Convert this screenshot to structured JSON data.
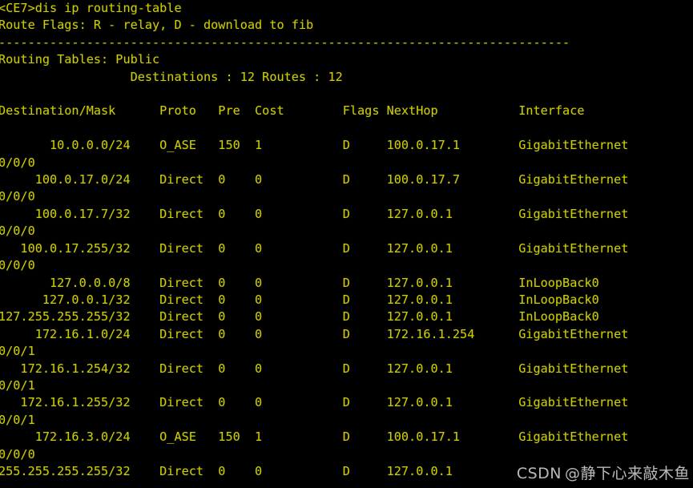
{
  "terminal": {
    "colors": {
      "background": "#000000",
      "foreground": "#cccc00"
    },
    "prompt": "<CE7>",
    "command": "dis ip routing-table",
    "prompt_line": "<CE7>dis ip routing-table",
    "route_flags_line": "Route Flags: R - relay, D - download to fib",
    "separator": "------------------------------------------------------------------------------",
    "routing_tables_line": "Routing Tables: Public",
    "summary_line": "        Destinations : 12       Routes : 12",
    "summary": {
      "destinations_label": "Destinations",
      "destinations_count": "12",
      "routes_label": "Routes",
      "routes_count": "12"
    },
    "column_headers": {
      "destination_mask": "Destination/Mask",
      "proto": "Proto",
      "pre": "Pre",
      "cost": "Cost",
      "flags": "Flags",
      "nexthop": "NextHop",
      "interface": "Interface"
    },
    "header_line": "Destination/Mask    Proto   Pre  Cost      Flags NextHop         Interface",
    "routes": [
      {
        "destination": "10.0.0.0/24",
        "proto": "O_ASE",
        "pre": "150",
        "cost": "1",
        "flags": "D",
        "nexthop": "100.0.17.1",
        "interface": "GigabitEthernet",
        "interface_cont": "0/0/0",
        "wrapped": true
      },
      {
        "destination": "100.0.17.0/24",
        "proto": "Direct",
        "pre": "0",
        "cost": "0",
        "flags": "D",
        "nexthop": "100.0.17.7",
        "interface": "GigabitEthernet",
        "interface_cont": "0/0/0",
        "wrapped": true
      },
      {
        "destination": "100.0.17.7/32",
        "proto": "Direct",
        "pre": "0",
        "cost": "0",
        "flags": "D",
        "nexthop": "127.0.0.1",
        "interface": "GigabitEthernet",
        "interface_cont": "0/0/0",
        "wrapped": true
      },
      {
        "destination": "100.0.17.255/32",
        "proto": "Direct",
        "pre": "0",
        "cost": "0",
        "flags": "D",
        "nexthop": "127.0.0.1",
        "interface": "GigabitEthernet",
        "interface_cont": "0/0/0",
        "wrapped": true
      },
      {
        "destination": "127.0.0.0/8",
        "proto": "Direct",
        "pre": "0",
        "cost": "0",
        "flags": "D",
        "nexthop": "127.0.0.1",
        "interface": "InLoopBack0",
        "interface_cont": "",
        "wrapped": false
      },
      {
        "destination": "127.0.0.1/32",
        "proto": "Direct",
        "pre": "0",
        "cost": "0",
        "flags": "D",
        "nexthop": "127.0.0.1",
        "interface": "InLoopBack0",
        "interface_cont": "",
        "wrapped": false
      },
      {
        "destination": "127.255.255.255/32",
        "proto": "Direct",
        "pre": "0",
        "cost": "0",
        "flags": "D",
        "nexthop": "127.0.0.1",
        "interface": "InLoopBack0",
        "interface_cont": "",
        "wrapped": false
      },
      {
        "destination": "172.16.1.0/24",
        "proto": "Direct",
        "pre": "0",
        "cost": "0",
        "flags": "D",
        "nexthop": "172.16.1.254",
        "interface": "GigabitEthernet",
        "interface_cont": "0/0/1",
        "wrapped": true
      },
      {
        "destination": "172.16.1.254/32",
        "proto": "Direct",
        "pre": "0",
        "cost": "0",
        "flags": "D",
        "nexthop": "127.0.0.1",
        "interface": "GigabitEthernet",
        "interface_cont": "0/0/1",
        "wrapped": true
      },
      {
        "destination": "172.16.1.255/32",
        "proto": "Direct",
        "pre": "0",
        "cost": "0",
        "flags": "D",
        "nexthop": "127.0.0.1",
        "interface": "GigabitEthernet",
        "interface_cont": "0/0/1",
        "wrapped": true
      },
      {
        "destination": "172.16.3.0/24",
        "proto": "O_ASE",
        "pre": "150",
        "cost": "1",
        "flags": "D",
        "nexthop": "100.0.17.1",
        "interface": "GigabitEthernet",
        "interface_cont": "0/0/0",
        "wrapped": true
      },
      {
        "destination": "255.255.255.255/32",
        "proto": "Direct",
        "pre": "0",
        "cost": "0",
        "flags": "D",
        "nexthop": "127.0.0.1",
        "interface": "",
        "interface_cont": "",
        "wrapped": false
      }
    ]
  },
  "watermark": {
    "brand": "CSDN",
    "author": "@静下心来敲木鱼"
  }
}
